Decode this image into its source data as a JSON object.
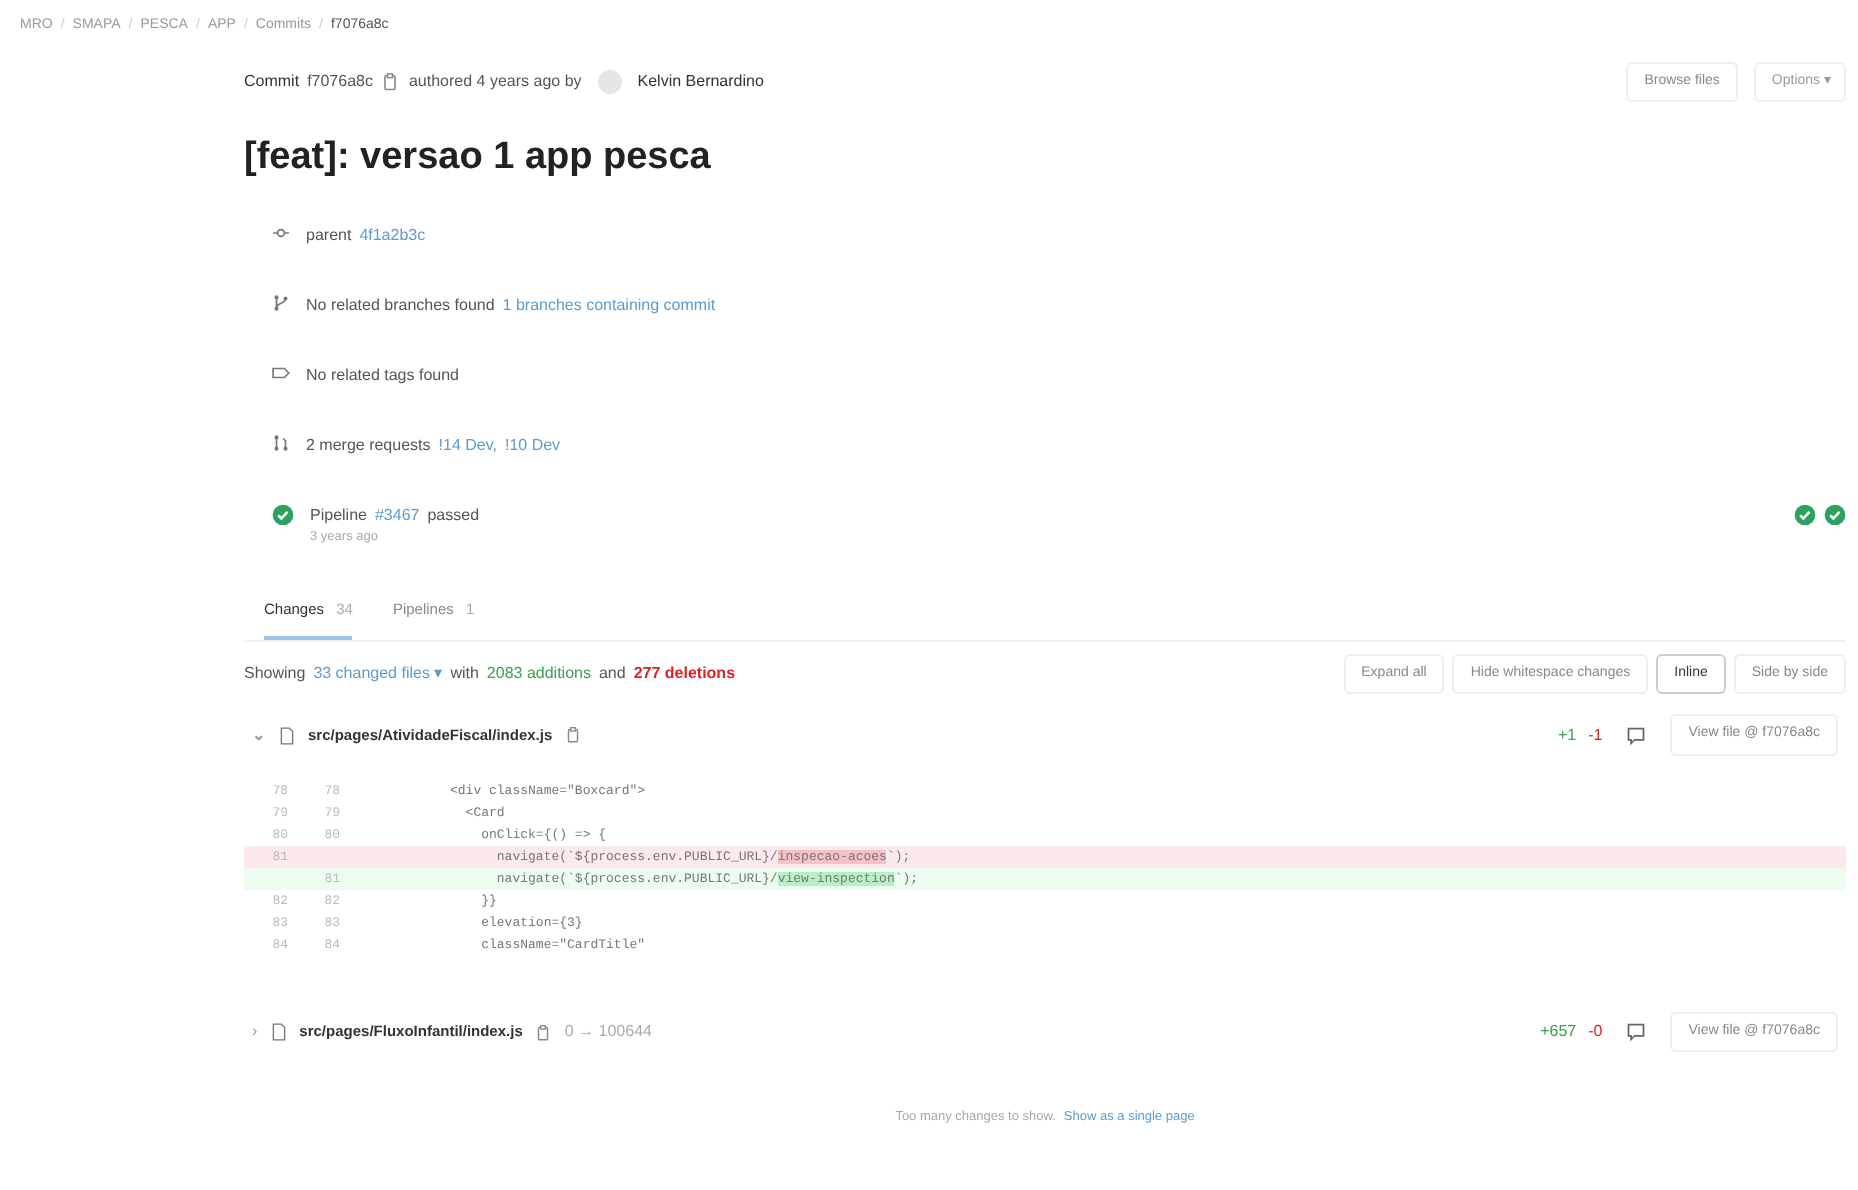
{
  "breadcrumb": [
    {
      "label": "MRO"
    },
    {
      "separator": "/",
      "label": "SMAPA"
    },
    {
      "separator": "/",
      "label": "PESCA"
    },
    {
      "separator": "/",
      "label": "APP"
    },
    {
      "separator": "/",
      "label": "Commits"
    },
    {
      "separator": "/",
      "label": "f7076a8c"
    }
  ],
  "commit": {
    "label": "Commit",
    "sha": "f7076a8c",
    "authored": "authored 4 years ago by",
    "author": "Kelvin Bernardino",
    "actions": [
      {
        "label": "Browse files",
        "kind": "button"
      },
      {
        "label": "Options ▾",
        "kind": "dropdown"
      }
    ]
  },
  "title": "[feat]: versao 1 app pesca",
  "info_rows": [
    {
      "kind": "parent",
      "text": "parent",
      "links": [
        "4f1a2b3c"
      ]
    },
    {
      "kind": "branch",
      "text": "No related branches found",
      "links": [
        "1 branches containing commit"
      ]
    },
    {
      "kind": "tag",
      "text": "No related tags found",
      "links": []
    },
    {
      "kind": "merge",
      "text": "2 merge requests",
      "links": [
        "!14 Dev,",
        "!10 Dev"
      ]
    },
    {
      "kind": "pipeline",
      "text": "Pipeline",
      "links": [
        "#3467"
      ],
      "suffix": "passed",
      "time": "3 years ago",
      "stages": [
        {
          "passed": true
        },
        {
          "passed": true
        }
      ]
    }
  ],
  "tabs": [
    {
      "label": "Changes",
      "count": "34",
      "selected": true
    },
    {
      "label": "Pipelines",
      "count": "1",
      "selected": false
    }
  ],
  "summary": {
    "prefix": "Showing",
    "files": "33 changed files ▾",
    "middle": "with",
    "additions": "2083 additions",
    "and": "and",
    "deletions": "277 deletions"
  },
  "view_buttons": [
    {
      "label": "Expand all",
      "selected": false
    },
    {
      "label": "Hide whitespace changes",
      "selected": false
    },
    {
      "label": "Inline",
      "selected": true
    },
    {
      "label": "Side by side",
      "selected": false
    }
  ],
  "files": [
    {
      "toggle": "⌄",
      "path": "src/pages/AtividadeFiscal/index.js",
      "added": "+1",
      "removed": "-1",
      "view": "View file @ f7076a8c",
      "expanded": true,
      "lines": [
        {
          "kind": "context",
          "old": "78",
          "new": "78",
          "segments": [
            {
              "text": "          <div className=\"Boxcard\">",
              "highlight": false
            }
          ]
        },
        {
          "kind": "context",
          "old": "79",
          "new": "79",
          "segments": [
            {
              "text": "            <Card",
              "highlight": false
            }
          ]
        },
        {
          "kind": "context",
          "old": "80",
          "new": "80",
          "segments": [
            {
              "text": "              onClick={() => {",
              "highlight": false
            }
          ]
        },
        {
          "kind": "removed",
          "old": "81",
          "segments": [
            {
              "text": "                navigate(`${process.env.PUBLIC_URL}/",
              "highlight": false
            },
            {
              "text": "inspecao-acoes",
              "highlight": true
            },
            {
              "text": "`);",
              "highlight": false
            }
          ]
        },
        {
          "kind": "added",
          "new": "81",
          "segments": [
            {
              "text": "                navigate(`${process.env.PUBLIC_URL}/",
              "highlight": false
            },
            {
              "text": "view-inspection",
              "highlight": true
            },
            {
              "text": "`);",
              "highlight": false
            }
          ]
        },
        {
          "kind": "context",
          "old": "82",
          "new": "82",
          "segments": [
            {
              "text": "              }}",
              "highlight": false
            }
          ]
        },
        {
          "kind": "context",
          "old": "83",
          "new": "83",
          "segments": [
            {
              "text": "              elevation={3}",
              "highlight": false
            }
          ]
        },
        {
          "kind": "context",
          "old": "84",
          "new": "84",
          "segments": [
            {
              "text": "              className=\"CardTitle\"",
              "highlight": false
            }
          ]
        }
      ]
    },
    {
      "toggle": "›",
      "path": "src/pages/FluxoInfantil/index.js",
      "mode": "0 → 100644",
      "added": "+657",
      "removed": "-0",
      "view": "View file @ f7076a8c",
      "expanded": false
    }
  ],
  "footer": {
    "text": "Too many changes to show.",
    "link": "Show as a single page"
  }
}
